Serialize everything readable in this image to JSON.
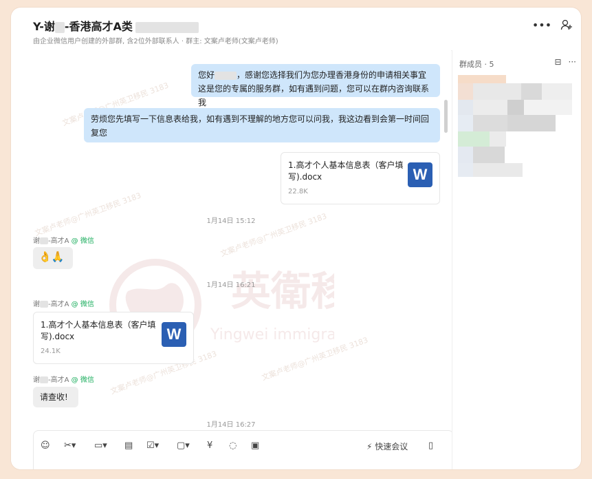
{
  "header": {
    "title_prefix": "Y-谢",
    "title_suffix": "-香港高才A类",
    "subtitle": "由企业微信用户创建的外部群, 含2位外部联系人 · 群主: 文案卢老师(文案卢老师)"
  },
  "icons": {
    "more": "more-icon",
    "add_member": "add-member-icon"
  },
  "members": {
    "label": "群成员 · 5"
  },
  "messages": {
    "m1_line1_a": "您好",
    "m1_line1_b": "，感谢您选择我们为您办理香港身份的申请相关事宜",
    "m1_line2": "这是您的专属的服务群，如有遇到问题，您可以在群内咨询联系我",
    "m2": "劳烦您先填写一下信息表给我，如有遇到不理解的地方您可以问我，我这边看到会第一时间回复您",
    "file1_name": "1.高才个人基本信息表（客户填写).docx",
    "file1_size": "22.8K",
    "time1": "1月14日 15:12",
    "sender1": "谢",
    "sender_suffix": "-高才A",
    "sender_tag": "@ 微信",
    "emoji1": "👌🙏",
    "time2": "1月14日 16:21",
    "file2_name": "1.高才个人基本信息表（客户填写).docx",
    "file2_size": "24.1K",
    "reply": "请查收!",
    "time3": "1月14日 16:27"
  },
  "file_icon_letter": "W",
  "toolbar": {
    "meeting": "快速会议"
  },
  "watermark": {
    "brand_cn": "英衛移民",
    "brand_en": "Yingwei immigration",
    "text": "文案卢老师@广州英卫移民 3183"
  },
  "colors": {
    "bubble_out": "#cfe6fb",
    "word": "#2b5fb3",
    "wechat_green": "#1aad5c"
  }
}
